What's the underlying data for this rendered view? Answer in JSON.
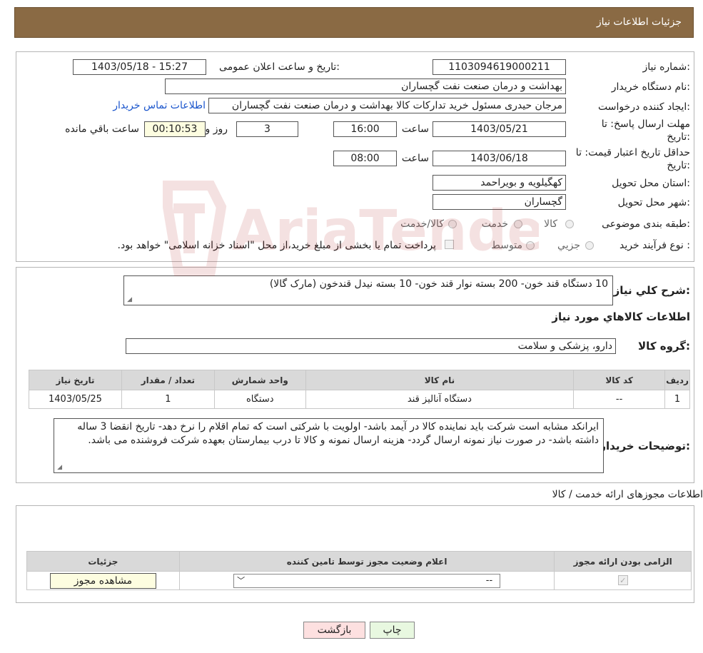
{
  "header": {
    "title": "جزئیات اطلاعات نیاز"
  },
  "form": {
    "need_number_label": "شماره نیاز:",
    "need_number": "1103094619000211",
    "announce_label": "تاریخ و ساعت اعلان عمومی:",
    "announce_value": "1403/05/18 - 15:27",
    "buyer_org_label": "نام دستگاه خریدار:",
    "buyer_org": "بهداشت و درمان صنعت نفت گچساران",
    "requester_label": "ایجاد کننده درخواست:",
    "requester": "مرجان  حیدری مسئول خرید تدارکات کالا  بهداشت و درمان صنعت نفت گچساران",
    "contact_link": "اطلاعات تماس خریدار",
    "deadline_label_1": "مهلت ارسال پاسخ: تا",
    "deadline_label_2": "تاریخ:",
    "deadline_date": "1403/05/21",
    "time_label": "ساعت",
    "deadline_time": "16:00",
    "days_value": "3",
    "days_label": "روز و",
    "remaining_time": "00:10:53",
    "remaining_label": "ساعت باقي مانده",
    "validity_label_1": "حداقل تاریخ اعتبار قیمت: تا",
    "validity_label_2": "تاریخ:",
    "validity_date": "1403/06/18",
    "validity_time": "08:00",
    "province_label": "استان محل تحویل:",
    "province": "کهگیلویه و بویراحمد",
    "city_label": "شهر محل تحویل:",
    "city": "گچساران",
    "category_label": "طبقه بندی موضوعی:",
    "category_options": [
      "کالا",
      "خدمت",
      "کالا/خدمت"
    ],
    "process_label": "نوع فرآیند خرید :",
    "process_options": [
      "جزیي",
      "متوسط"
    ],
    "process_note": "پرداخت تمام یا بخشی از مبلغ خرید،از محل \"اسناد خزانه اسلامی\" خواهد بود."
  },
  "details": {
    "summary_label": "شرح کلي نياز:",
    "summary": "10 دستگاه قند خون- 200 بسته نوار قند خون- 10 بسته نیدل قندخون (مارک گالا)",
    "items_title": "اطلاعات کالاهاي مورد نياز",
    "group_label": "گروه کالا:",
    "group": "دارو، پزشکی و سلامت",
    "table_headers": [
      "رديف",
      "کد کالا",
      "نام کالا",
      "واحد شمارش",
      "تعداد / مقدار",
      "تاریخ نیاز"
    ],
    "table_rows": [
      [
        "1",
        "--",
        "دستگاه آنالیز قند",
        "دستگاه",
        "1",
        "1403/05/25"
      ]
    ],
    "buyer_notes_label": "توضیحات خریدار:",
    "buyer_notes": "ایرانکد مشابه است شرکت باید نماینده کالا در آیمد باشد- اولویت با شرکتی است که تمام اقلام را نرخ دهد- تاریخ انقضا 3 ساله داشته باشد- در صورت نیاز نمونه ارسال گردد- هزینه ارسال نمونه و کالا تا درب بیمارستان بعهده شرکت فروشنده می باشد."
  },
  "permits": {
    "title": "اطلاعات مجوزهای ارائه خدمت / کالا",
    "headers": [
      "الزامی بودن ارائه مجوز",
      "اعلام وضعیت مجوز توسط تامین کننده",
      "جزئیات"
    ],
    "select_value": "--",
    "view_button": "مشاهده مجوز"
  },
  "footer": {
    "print_button": "چاپ",
    "back_button": "بازگشت"
  },
  "watermark_text": "AriaTender.neT",
  "colors": {
    "header_bg": "#8a6a44",
    "link": "#1a55cc",
    "back_btn": "#fde0e0",
    "print_btn": "#e8f8e0"
  }
}
